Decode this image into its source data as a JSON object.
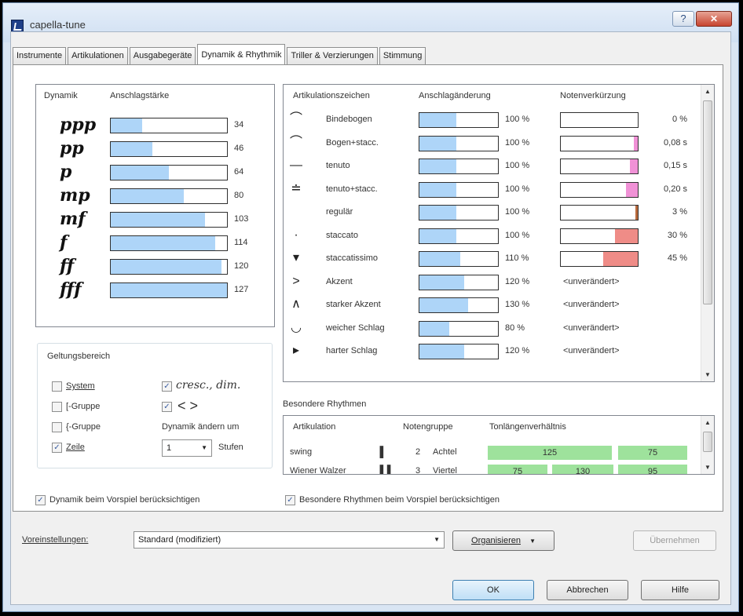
{
  "window": {
    "title": "capella-tune",
    "help_glyph": "?",
    "close_glyph": "✕"
  },
  "tabs": [
    "Instrumente",
    "Artikulationen",
    "Ausgabegeräte",
    "Dynamik & Rhythmik",
    "Triller & Verzierungen",
    "Stimmung"
  ],
  "dynamics": {
    "header_dynamik": "Dynamik",
    "header_strength": "Anschlagstärke",
    "rows": [
      {
        "symbol": "ppp",
        "value": 34,
        "fraction": 0.27
      },
      {
        "symbol": "pp",
        "value": 46,
        "fraction": 0.36
      },
      {
        "symbol": "p",
        "value": 64,
        "fraction": 0.5
      },
      {
        "symbol": "mp",
        "value": 80,
        "fraction": 0.63
      },
      {
        "symbol": "mf",
        "value": 103,
        "fraction": 0.81
      },
      {
        "symbol": "f",
        "value": 114,
        "fraction": 0.9
      },
      {
        "symbol": "ff",
        "value": 120,
        "fraction": 0.95
      },
      {
        "symbol": "fff",
        "value": 127,
        "fraction": 1.0
      }
    ]
  },
  "articulations": {
    "header_sign": "Artikulationszeichen",
    "header_change": "Anschlagänderung",
    "header_shorten": "Notenverkürzung",
    "rows": [
      {
        "icon": "⌒",
        "name": "Bindebogen",
        "change": "100 %",
        "change_fraction": 0.47,
        "shorten": "0 %",
        "shorten_fraction": 0,
        "shorten_color": "none"
      },
      {
        "icon": "⌒",
        "name": "Bogen+stacc.",
        "change": "100 %",
        "change_fraction": 0.47,
        "shorten": "0,08 s",
        "shorten_fraction": 0.05,
        "shorten_color": "pink"
      },
      {
        "icon": "—",
        "name": "tenuto",
        "change": "100 %",
        "change_fraction": 0.47,
        "shorten": "0,15 s",
        "shorten_fraction": 0.1,
        "shorten_color": "pink"
      },
      {
        "icon": "≐",
        "name": "tenuto+stacc.",
        "change": "100 %",
        "change_fraction": 0.47,
        "shorten": "0,20 s",
        "shorten_fraction": 0.15,
        "shorten_color": "pink"
      },
      {
        "icon": "",
        "name": "regulär",
        "change": "100 %",
        "change_fraction": 0.47,
        "shorten": "3 %",
        "shorten_fraction": 0.03,
        "shorten_color": "brown"
      },
      {
        "icon": "·",
        "name": "staccato",
        "change": "100 %",
        "change_fraction": 0.47,
        "shorten": "30 %",
        "shorten_fraction": 0.3,
        "shorten_color": "red"
      },
      {
        "icon": "▾",
        "name": "staccatissimo",
        "change": "110 %",
        "change_fraction": 0.52,
        "shorten": "45 %",
        "shorten_fraction": 0.45,
        "shorten_color": "red"
      },
      {
        "icon": ">",
        "name": "Akzent",
        "change": "120 %",
        "change_fraction": 0.57,
        "shorten": "<unverändert>",
        "shorten_fraction": null,
        "shorten_color": "none"
      },
      {
        "icon": "∧",
        "name": "starker Akzent",
        "change": "130 %",
        "change_fraction": 0.62,
        "shorten": "<unverändert>",
        "shorten_fraction": null,
        "shorten_color": "none"
      },
      {
        "icon": "◡",
        "name": "weicher Schlag",
        "change": "80 %",
        "change_fraction": 0.38,
        "shorten": "<unverändert>",
        "shorten_fraction": null,
        "shorten_color": "none"
      },
      {
        "icon": "▸",
        "name": "harter Schlag",
        "change": "120 %",
        "change_fraction": 0.57,
        "shorten": "<unverändert>",
        "shorten_fraction": null,
        "shorten_color": "none"
      }
    ]
  },
  "scope": {
    "title": "Geltungsbereich",
    "system": {
      "label": "System",
      "checked": false
    },
    "group1": {
      "label": "[-Gruppe",
      "checked": false
    },
    "group2": {
      "label": "{-Gruppe",
      "checked": false
    },
    "line": {
      "label": "Zeile",
      "checked": true
    },
    "cresc": {
      "label": "cresc., dim.",
      "checked": true
    },
    "hairpin": {
      "label": "<  >",
      "checked": true
    },
    "change_label": "Dynamik ändern um",
    "steps_value": "1",
    "steps_label": "Stufen"
  },
  "rhythms": {
    "title": "Besondere Rhythmen",
    "header_art": "Artikulation",
    "header_group": "Notengruppe",
    "header_ratio": "Tonlängenverhältnis",
    "rows": [
      {
        "name": "swing",
        "count": "2",
        "unit": "Achtel",
        "ratios": [
          "125",
          "75"
        ]
      },
      {
        "name": "Wiener Walzer",
        "count": "3",
        "unit": "Viertel",
        "ratios": [
          "75",
          "130",
          "95"
        ]
      }
    ]
  },
  "options": {
    "dyn_playback": {
      "label": "Dynamik beim Vorspiel berücksichtigen",
      "checked": true
    },
    "rhythm_playback": {
      "label": "Besondere Rhythmen beim Vorspiel berücksichtigen",
      "checked": true
    }
  },
  "presets": {
    "label": "Voreinstellungen:",
    "value": "Standard (modifiziert)",
    "organize": "Organisieren",
    "apply": "Übernehmen"
  },
  "buttons": {
    "ok": "OK",
    "cancel": "Abbrechen",
    "help": "Hilfe"
  },
  "colors": {
    "bar_blue": "#aed5f8",
    "pink": "#f091d6",
    "red": "#ef8c87",
    "green": "#9ee29c"
  }
}
